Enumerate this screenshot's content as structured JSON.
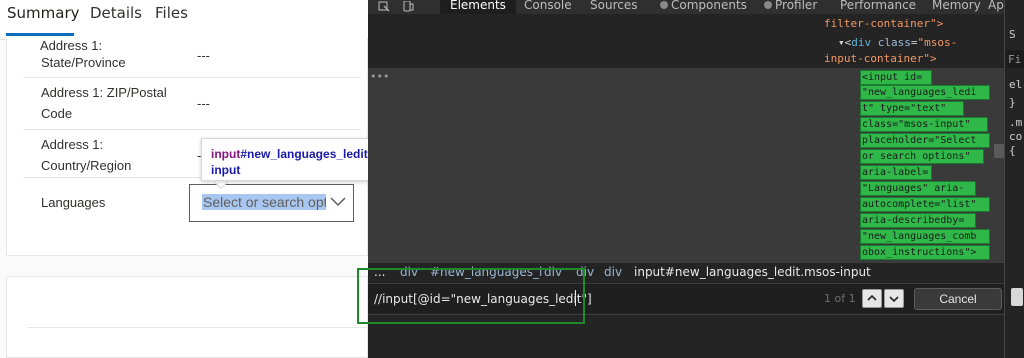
{
  "form": {
    "tabs": [
      "Summary",
      "Details",
      "Files"
    ],
    "active_tab": "Summary",
    "cut_label": "Address 1:",
    "rows": [
      {
        "label": "State/Province",
        "value": "---"
      },
      {
        "label": "Address 1: ZIP/Postal Code",
        "value": "---"
      },
      {
        "label": "Address 1: Country/Region",
        "value": "---"
      },
      {
        "label": "Languages",
        "value": ""
      }
    ],
    "languages_placeholder": "Select or search options",
    "tooltip": {
      "tag": "input",
      "id": "#new_languages_ledit",
      "type": "input"
    }
  },
  "devtools": {
    "tabs": [
      "Elements",
      "Console",
      "Sources",
      "Components",
      "Profiler",
      "Performance",
      "Memory",
      "App"
    ],
    "active_tab": "Elements",
    "dom_top": [
      {
        "text": "filter-container\">"
      },
      {
        "tag": "div",
        "attr": "class",
        "val": "\"msos-"
      },
      {
        "text": "input-container\">"
      }
    ],
    "highlight_lines": [
      "<input id=",
      "\"new_languages_ledi",
      "t\" type=\"text\"",
      "class=\"msos-input\"",
      "placeholder=\"Select",
      "or search options\"",
      "aria-label=",
      "\"Languages\" aria-",
      "autocomplete=\"list\"",
      "aria-describedby=",
      "\"new_languages_comb",
      "obox_instructions\">"
    ],
    "breadcrumbs": [
      "...",
      "div",
      "#new_languages_i",
      "div",
      "div",
      "div",
      "input#new_languages_ledit.msos-input"
    ],
    "search_value": "//input[@id=\"new_languages_ledit\"]",
    "match_count": "1 of 1",
    "cancel_label": "Cancel",
    "styles_lines": [
      "S",
      "Fi",
      "el",
      "}",
      ".m",
      "co",
      "{"
    ]
  },
  "colors": {
    "highlight": "#2fb74a",
    "frame": "#1f8a2a",
    "accent": "#0f6cbd"
  }
}
